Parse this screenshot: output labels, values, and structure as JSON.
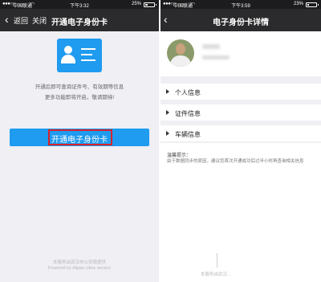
{
  "left": {
    "status": {
      "carrier": "中国联通",
      "time": "下午3:32",
      "battery": "25%",
      "battery_level": 0.25,
      "signal": "●●●○○",
      "wifi": "◠"
    },
    "nav": {
      "back_label": "返回",
      "close_label": "关闭",
      "title": "开通电子身份卡"
    },
    "info_line1": "开通后即可查询证件号、有效期等信息",
    "info_line2": "更多功能即将开启，敬请期待!",
    "button_label": "开通电子身份卡",
    "footer_line1": "本服务由武汉市公安局提供",
    "footer_line2": "Powered by Alipay cities service"
  },
  "right": {
    "status": {
      "carrier": "中国联通",
      "time": "下午3:59",
      "battery": "23%",
      "battery_level": 0.23,
      "signal": "●●●○○",
      "wifi": "◠"
    },
    "nav": {
      "title": "电子身份卡详情"
    },
    "sections": [
      {
        "label": "个人信息"
      },
      {
        "label": "证件信息"
      },
      {
        "label": "车辆信息"
      }
    ],
    "tips_title": "温馨提示：",
    "tips_body": "由于数据同步的原因，建议您首次开通成功后过半小时再查询相关信息",
    "footer": "本服务由武汉..."
  },
  "colors": {
    "accent": "#1f9bf0",
    "highlight": "#d8232a",
    "navbar": "#2b2b2d",
    "background": "#efeff4"
  },
  "icons": {
    "back": "chevron-left-icon",
    "card": "id-card-icon",
    "caret": "caret-right-icon"
  }
}
